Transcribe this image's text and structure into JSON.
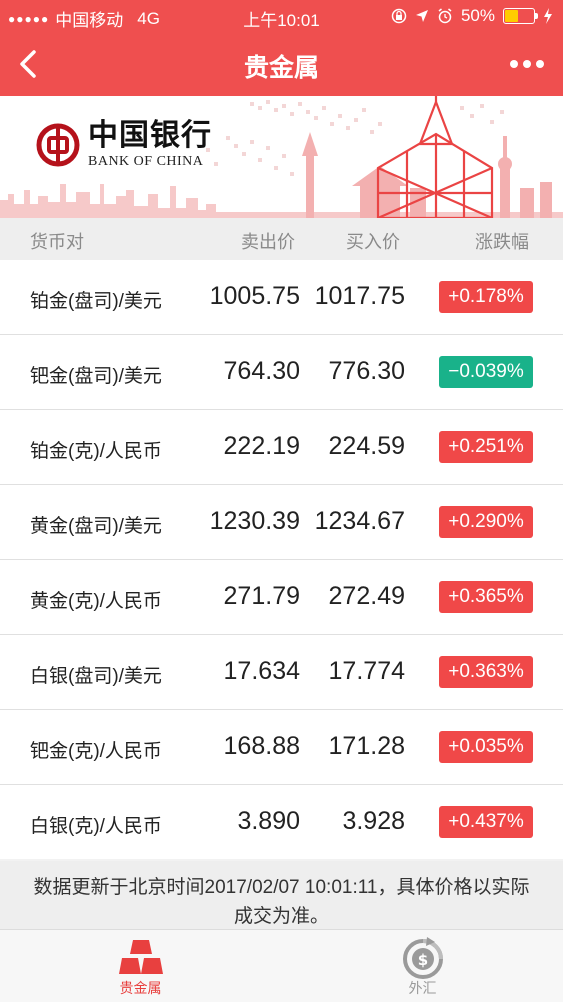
{
  "status_bar": {
    "signal": "●●●●●",
    "carrier": "中国移动",
    "network": "4G",
    "time": "上午10:01",
    "battery": "50%",
    "battery_level": 0.5
  },
  "nav": {
    "title": "贵金属"
  },
  "banner": {
    "logo_cn": "中国银行",
    "logo_en": "BANK OF CHINA"
  },
  "table": {
    "headers": {
      "pair": "货币对",
      "sell": "卖出价",
      "buy": "买入价",
      "change": "涨跌幅"
    },
    "rows": [
      {
        "name": "铂金(盘司)/美元",
        "sell": "1005.75",
        "buy": "1017.75",
        "change": "+0.178%",
        "direction": "up"
      },
      {
        "name": "钯金(盘司)/美元",
        "sell": "764.30",
        "buy": "776.30",
        "change": "−0.039%",
        "direction": "down"
      },
      {
        "name": "铂金(克)/人民币",
        "sell": "222.19",
        "buy": "224.59",
        "change": "+0.251%",
        "direction": "up"
      },
      {
        "name": "黄金(盘司)/美元",
        "sell": "1230.39",
        "buy": "1234.67",
        "change": "+0.290%",
        "direction": "up"
      },
      {
        "name": "黄金(克)/人民币",
        "sell": "271.79",
        "buy": "272.49",
        "change": "+0.365%",
        "direction": "up"
      },
      {
        "name": "白银(盘司)/美元",
        "sell": "17.634",
        "buy": "17.774",
        "change": "+0.363%",
        "direction": "up"
      },
      {
        "name": "钯金(克)/人民币",
        "sell": "168.88",
        "buy": "171.28",
        "change": "+0.035%",
        "direction": "up"
      },
      {
        "name": "白银(克)/人民币",
        "sell": "3.890",
        "buy": "3.928",
        "change": "+0.437%",
        "direction": "up"
      }
    ]
  },
  "note": "数据更新于北京时间2017/02/07 10:01:11，具体价格以实际成交为准。",
  "tabs": [
    {
      "label": "贵金属",
      "active": true,
      "icon": "gold-bars-icon"
    },
    {
      "label": "外汇",
      "active": false,
      "icon": "currency-exchange-icon"
    }
  ],
  "colors": {
    "brand": "#ef4f4f",
    "up": "#f04848",
    "down": "#19b28a",
    "tab_active": "#e8403f",
    "tab_inactive": "#9a9a9a"
  }
}
